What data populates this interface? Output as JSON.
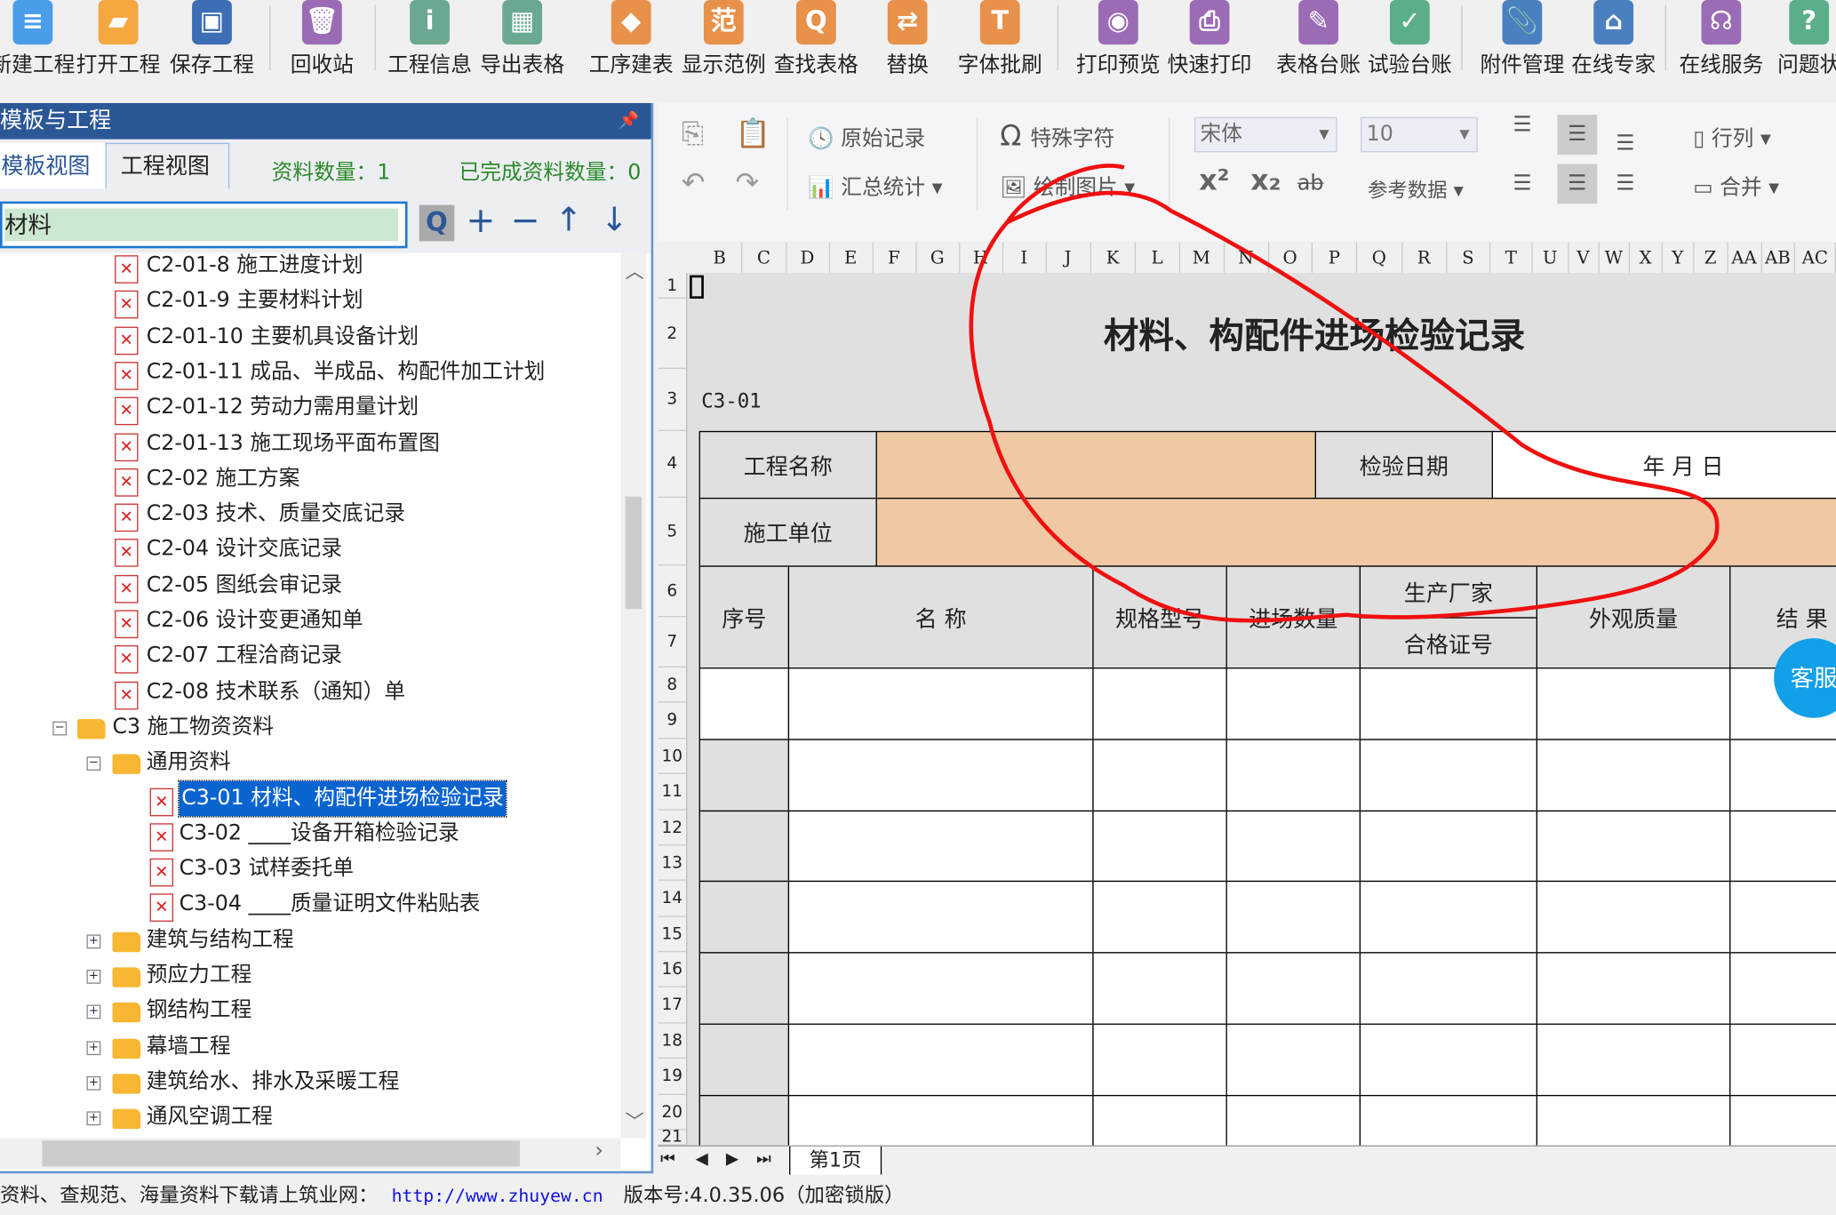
{
  "toolbar": {
    "items": [
      {
        "label": "新建工程",
        "icon": "new-file-icon",
        "color": "#4a9de8",
        "glyph": "≡"
      },
      {
        "label": "打开工程",
        "icon": "open-folder-icon",
        "color": "#f5a742",
        "glyph": "▰"
      },
      {
        "label": "保存工程",
        "icon": "save-icon",
        "color": "#3d6db5",
        "glyph": "▣"
      },
      {
        "label": "回收站",
        "icon": "trash-icon",
        "color": "#9b6bb5",
        "glyph": "🗑"
      },
      {
        "label": "工程信息",
        "icon": "info-icon",
        "color": "#6aa890",
        "glyph": "i"
      },
      {
        "label": "导出表格",
        "icon": "export-table-icon",
        "color": "#6aa890",
        "glyph": "▦"
      },
      {
        "label": "工序建表",
        "icon": "layers-icon",
        "color": "#e8914a",
        "glyph": "◆"
      },
      {
        "label": "显示范例",
        "icon": "example-icon",
        "color": "#e8914a",
        "glyph": "范"
      },
      {
        "label": "查找表格",
        "icon": "search-table-icon",
        "color": "#e8914a",
        "glyph": "Q"
      },
      {
        "label": "替换",
        "icon": "replace-icon",
        "color": "#e8914a",
        "glyph": "⇄"
      },
      {
        "label": "字体批刷",
        "icon": "font-brush-icon",
        "color": "#e8914a",
        "glyph": "T"
      },
      {
        "label": "打印预览",
        "icon": "print-preview-icon",
        "color": "#9b6bb5",
        "glyph": "◉"
      },
      {
        "label": "快速打印",
        "icon": "printer-icon",
        "color": "#9b6bb5",
        "glyph": "⎙"
      },
      {
        "label": "表格台账",
        "icon": "ledger-icon",
        "color": "#9b6bb5",
        "glyph": "✎"
      },
      {
        "label": "试验台账",
        "icon": "test-ledger-icon",
        "color": "#5aae8a",
        "glyph": "✓"
      },
      {
        "label": "附件管理",
        "icon": "paperclip-icon",
        "color": "#4a80c0",
        "glyph": "📎"
      },
      {
        "label": "在线专家",
        "icon": "expert-icon",
        "color": "#4a80c0",
        "glyph": "⌂"
      },
      {
        "label": "在线服务",
        "icon": "headset-icon",
        "color": "#9b6bb5",
        "glyph": "☊"
      },
      {
        "label": "问题状",
        "icon": "help-icon",
        "color": "#5aae8a",
        "glyph": "?"
      }
    ]
  },
  "panel": {
    "title": "模板与工程",
    "tabs": [
      "模板视图",
      "工程视图"
    ],
    "count_label": "资料数量：1",
    "done_label": "已完成资料数量：0",
    "search_value": "材料",
    "tree": [
      {
        "level": "c2",
        "type": "doc",
        "label": "C2-01-8  施工进度计划"
      },
      {
        "level": "c2",
        "type": "doc",
        "label": "C2-01-9  主要材料计划"
      },
      {
        "level": "c2",
        "type": "doc",
        "label": "C2-01-10  主要机具设备计划"
      },
      {
        "level": "c2",
        "type": "doc",
        "label": "C2-01-11  成品、半成品、构配件加工计划"
      },
      {
        "level": "c2",
        "type": "doc",
        "label": "C2-01-12  劳动力需用量计划"
      },
      {
        "level": "c2",
        "type": "doc",
        "label": "C2-01-13  施工现场平面布置图"
      },
      {
        "level": "c2",
        "type": "doc",
        "label": "C2-02  施工方案"
      },
      {
        "level": "c2",
        "type": "doc",
        "label": "C2-03  技术、质量交底记录"
      },
      {
        "level": "c2",
        "type": "doc",
        "label": "C2-04  设计交底记录"
      },
      {
        "level": "c2",
        "type": "doc",
        "label": "C2-05  图纸会审记录"
      },
      {
        "level": "c2",
        "type": "doc",
        "label": "C2-06  设计变更通知单"
      },
      {
        "level": "c2",
        "type": "doc",
        "label": "C2-07  工程洽商记录"
      },
      {
        "level": "c2",
        "type": "doc",
        "label": "C2-08  技术联系（通知）单"
      },
      {
        "level": "root",
        "type": "folder",
        "exp": "−",
        "label": "C3  施工物资资料"
      },
      {
        "level": "sub",
        "type": "folder",
        "exp": "−",
        "label": "通用资料"
      },
      {
        "level": "leaf",
        "type": "doc",
        "label": "C3-01  材料、构配件进场检验记录",
        "selected": true
      },
      {
        "level": "leaf",
        "type": "doc",
        "label": "C3-02  ____设备开箱检验记录"
      },
      {
        "level": "leaf",
        "type": "doc",
        "label": "C3-03  试样委托单"
      },
      {
        "level": "leaf",
        "type": "doc",
        "label": "C3-04  ____质量证明文件粘贴表"
      },
      {
        "level": "sub",
        "type": "folder",
        "exp": "+",
        "label": "建筑与结构工程"
      },
      {
        "level": "sub",
        "type": "folder",
        "exp": "+",
        "label": "预应力工程"
      },
      {
        "level": "sub",
        "type": "folder",
        "exp": "+",
        "label": "钢结构工程"
      },
      {
        "level": "sub",
        "type": "folder",
        "exp": "+",
        "label": "幕墙工程"
      },
      {
        "level": "sub",
        "type": "folder",
        "exp": "+",
        "label": "建筑给水、排水及采暖工程"
      },
      {
        "level": "sub",
        "type": "folder",
        "exp": "+",
        "label": "通风空调工程"
      }
    ]
  },
  "ribbon": {
    "original_record": "原始记录",
    "summary": "汇总统计",
    "special_char": "特殊字符",
    "draw_picture": "绘制图片",
    "font_name": "宋体",
    "font_size": "10",
    "reference_data": "参考数据",
    "row_col": "行列",
    "merge": "合并"
  },
  "sheet": {
    "columns": [
      "B",
      "C",
      "D",
      "E",
      "F",
      "G",
      "H",
      "I",
      "J",
      "K",
      "L",
      "M",
      "N",
      "O",
      "P",
      "Q",
      "R",
      "S",
      "T",
      "U",
      "V",
      "W",
      "X",
      "Y",
      "Z",
      "AA",
      "AB",
      "AC"
    ],
    "rows": [
      "1",
      "2",
      "3",
      "4",
      "5",
      "6",
      "7",
      "8",
      "9",
      "10",
      "11",
      "12",
      "13",
      "14",
      "15",
      "16",
      "17",
      "18",
      "19",
      "20",
      "21"
    ],
    "title": "材料、构配件进场检验记录",
    "code": "C3-01",
    "project_name_label": "工程名称",
    "inspect_date_label": "检验日期",
    "date_value": "年    月    日",
    "contractor_label": "施工单位",
    "headers": {
      "seq": "序号",
      "name": "名    称",
      "spec": "规格型号",
      "qty": "进场数量",
      "maker": "生产厂家",
      "cert": "合格证号",
      "appearance": "外观质量",
      "result": "结  果"
    },
    "sheet_tab": "第1页",
    "input_color": "#f0c8a4",
    "service_badge": "客服"
  },
  "status": {
    "text": "资料、查规范、海量资料下载请上筑业网：",
    "link": "http://www.zhuyew.cn",
    "version": "版本号:4.0.35.06（加密锁版）"
  }
}
